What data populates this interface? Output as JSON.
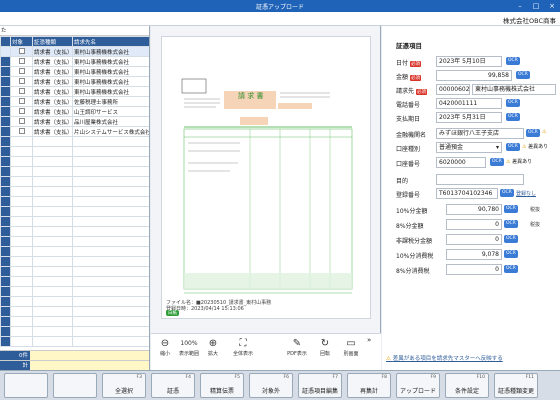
{
  "window": {
    "title": "証憑アップロード",
    "company": "株式会社OBC商事"
  },
  "list": {
    "top_label": "た",
    "headers": [
      "対象",
      "証憑種類",
      "請求先名"
    ],
    "rows": [
      {
        "type": "請求書（支払）",
        "name": "東村山事務機株式会社"
      },
      {
        "type": "請求書（支払）",
        "name": "東村山事務機株式会社"
      },
      {
        "type": "請求書（支払）",
        "name": "東村山事務機株式会社"
      },
      {
        "type": "請求書（支払）",
        "name": "東村山事務機株式会社"
      },
      {
        "type": "請求書（支払）",
        "name": "東村山事務機株式会社"
      },
      {
        "type": "請求書（支払）",
        "name": "佐藤税理士事務所"
      },
      {
        "type": "請求書（支払）",
        "name": "山王調印サービス"
      },
      {
        "type": "請求書（支払）",
        "name": "品川屋業株式会社"
      },
      {
        "type": "請求書（支払）",
        "name": "片山システムサービス株式会社"
      }
    ],
    "footer_count": "0件",
    "footer_total": "計"
  },
  "preview": {
    "doc_title": "請 求 書",
    "file_name": "ファイル名：■20230510_請求書_東村山事務",
    "registered": "登録日時：2023/04/14 15:13:06",
    "tag": "白紙",
    "zoom": "100%",
    "tools": [
      "縮小",
      "表示範囲",
      "拡大",
      "全体表示",
      "PDF表示",
      "回転",
      "別画面"
    ]
  },
  "form": {
    "heading": "証憑項目",
    "required_label": "必須",
    "ocr_label": "OCR",
    "fields": {
      "date": {
        "label": "日付",
        "value": "2023年 5月10日"
      },
      "amount": {
        "label": "金額",
        "value": "99,858"
      },
      "vendor": {
        "label": "請求先",
        "code": "00000602",
        "name": "東村山事務機株式会社"
      },
      "phone": {
        "label": "電話番号",
        "value": "0420001111"
      },
      "due": {
        "label": "支払期日",
        "value": "2023年 5月31日"
      },
      "bank": {
        "label": "金融機関名",
        "value": "みずほ銀行八王子支店",
        "warn": "差異あり"
      },
      "acct_type": {
        "label": "口座種別",
        "value": "普通預金",
        "warn": "差異あり"
      },
      "acct_no": {
        "label": "口座番号",
        "value": "6020000",
        "warn": "差異あり"
      },
      "purpose": {
        "label": "目的",
        "value": ""
      },
      "reg_no": {
        "label": "登録番号",
        "value": "T6013704102346",
        "link": "登録なし"
      },
      "amt10": {
        "label": "10%分金額",
        "value": "90,780",
        "note": "税抜"
      },
      "amt8": {
        "label": "8%分金額",
        "value": "0",
        "note": "税抜"
      },
      "nontax": {
        "label": "非課税分金額",
        "value": "0"
      },
      "tax10": {
        "label": "10%分消費税",
        "value": "9,078"
      },
      "tax8": {
        "label": "8%分消費税",
        "value": "0"
      }
    },
    "footnote": "差異がある項目を請求先マスターへ反映する"
  },
  "fkeys": [
    {
      "n": "",
      "l": ""
    },
    {
      "n": "",
      "l": ""
    },
    {
      "n": "F3",
      "l": "全選択"
    },
    {
      "n": "F4",
      "l": "証憑"
    },
    {
      "n": "F5",
      "l": "精算伝票"
    },
    {
      "n": "F6",
      "l": "対象外"
    },
    {
      "n": "F7",
      "l": "証憑項目編集"
    },
    {
      "n": "F8",
      "l": "再集計"
    },
    {
      "n": "F9",
      "l": "アップロード"
    },
    {
      "n": "F10",
      "l": "条件設定"
    },
    {
      "n": "F11",
      "l": "証憑種類変更"
    }
  ]
}
